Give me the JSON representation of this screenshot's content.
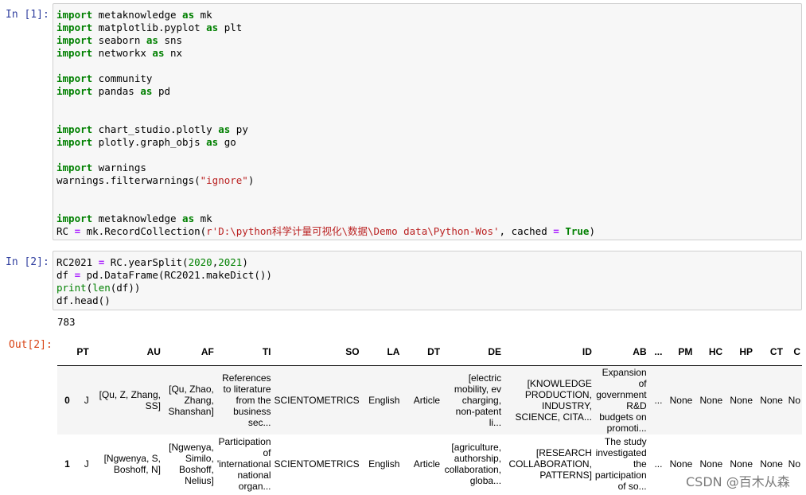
{
  "cells": [
    {
      "prompt": "In  [1]:",
      "lines": [
        [
          {
            "t": "import",
            "c": "kw"
          },
          {
            "t": " metaknowledge "
          },
          {
            "t": "as",
            "c": "kw"
          },
          {
            "t": " mk"
          }
        ],
        [
          {
            "t": "import",
            "c": "kw"
          },
          {
            "t": " matplotlib.pyplot "
          },
          {
            "t": "as",
            "c": "kw"
          },
          {
            "t": " plt"
          }
        ],
        [
          {
            "t": "import",
            "c": "kw"
          },
          {
            "t": " seaborn "
          },
          {
            "t": "as",
            "c": "kw"
          },
          {
            "t": " sns"
          }
        ],
        [
          {
            "t": "import",
            "c": "kw"
          },
          {
            "t": " networkx "
          },
          {
            "t": "as",
            "c": "kw"
          },
          {
            "t": " nx"
          }
        ],
        [],
        [
          {
            "t": "import",
            "c": "kw"
          },
          {
            "t": " community"
          }
        ],
        [
          {
            "t": "import",
            "c": "kw"
          },
          {
            "t": " pandas "
          },
          {
            "t": "as",
            "c": "kw"
          },
          {
            "t": " pd"
          }
        ],
        [],
        [],
        [
          {
            "t": "import",
            "c": "kw"
          },
          {
            "t": " chart_studio.plotly "
          },
          {
            "t": "as",
            "c": "kw"
          },
          {
            "t": " py"
          }
        ],
        [
          {
            "t": "import",
            "c": "kw"
          },
          {
            "t": " plotly.graph_objs "
          },
          {
            "t": "as",
            "c": "kw"
          },
          {
            "t": " go"
          }
        ],
        [],
        [
          {
            "t": "import",
            "c": "kw"
          },
          {
            "t": " warnings"
          }
        ],
        [
          {
            "t": "warnings.filterwarnings("
          },
          {
            "t": "\"ignore\"",
            "c": "str"
          },
          {
            "t": ")"
          }
        ],
        [],
        [],
        [
          {
            "t": "import",
            "c": "kw"
          },
          {
            "t": " metaknowledge "
          },
          {
            "t": "as",
            "c": "kw"
          },
          {
            "t": " mk"
          }
        ],
        [
          {
            "t": "RC "
          },
          {
            "t": "=",
            "c": "op"
          },
          {
            "t": " mk.RecordCollection("
          },
          {
            "t": "r'D:\\python科学计量可视化\\数据\\Demo data\\Python-Wos'",
            "c": "str"
          },
          {
            "t": ", cached "
          },
          {
            "t": "=",
            "c": "op"
          },
          {
            "t": " "
          },
          {
            "t": "True",
            "c": "kw"
          },
          {
            "t": ")"
          }
        ]
      ]
    },
    {
      "prompt": "In  [2]:",
      "lines": [
        [
          {
            "t": "RC2021 "
          },
          {
            "t": "=",
            "c": "op"
          },
          {
            "t": " RC.yearSplit("
          },
          {
            "t": "2020",
            "c": "num"
          },
          {
            "t": ","
          },
          {
            "t": "2021",
            "c": "num"
          },
          {
            "t": ")"
          }
        ],
        [
          {
            "t": "df "
          },
          {
            "t": "=",
            "c": "op"
          },
          {
            "t": " pd.DataFrame(RC2021.makeDict())"
          }
        ],
        [
          {
            "t": "print",
            "c": "bi"
          },
          {
            "t": "("
          },
          {
            "t": "len",
            "c": "bi"
          },
          {
            "t": "(df))"
          }
        ],
        [
          {
            "t": "df.head()"
          }
        ]
      ]
    }
  ],
  "stdout": "783",
  "out_prompt": "Out[2]:",
  "table": {
    "columns": [
      "",
      "PT",
      "AU",
      "AF",
      "TI",
      "SO",
      "LA",
      "DT",
      "DE",
      "ID",
      "AB",
      "...",
      "PM",
      "HC",
      "HP",
      "CT",
      "C"
    ],
    "rows": [
      [
        "0",
        "J",
        "[Qu, Z, Zhang, SS]",
        "[Qu, Zhao, Zhang, Shanshan]",
        "References to literature from the business sec...",
        "SCIENTOMETRICS",
        "English",
        "Article",
        "[electric mobility, ev charging, non-patent li...",
        "[KNOWLEDGE PRODUCTION, INDUSTRY, SCIENCE, CITA...",
        "Expansion of government R&D budgets on promoti...",
        "...",
        "None",
        "None",
        "None",
        "None",
        "No"
      ],
      [
        "1",
        "J",
        "[Ngwenya, S, Boshoff, N]",
        "[Ngwenya, Similo, Boshoff, Nelius]",
        "Participation of 'international national organ...",
        "SCIENTOMETRICS",
        "English",
        "Article",
        "[agriculture, authorship, collaboration, globa...",
        "[RESEARCH COLLABORATION, PATTERNS]",
        "The study investigated the participation of so...",
        "...",
        "None",
        "None",
        "None",
        "None",
        "No"
      ]
    ]
  },
  "watermark": "CSDN @百木从森"
}
